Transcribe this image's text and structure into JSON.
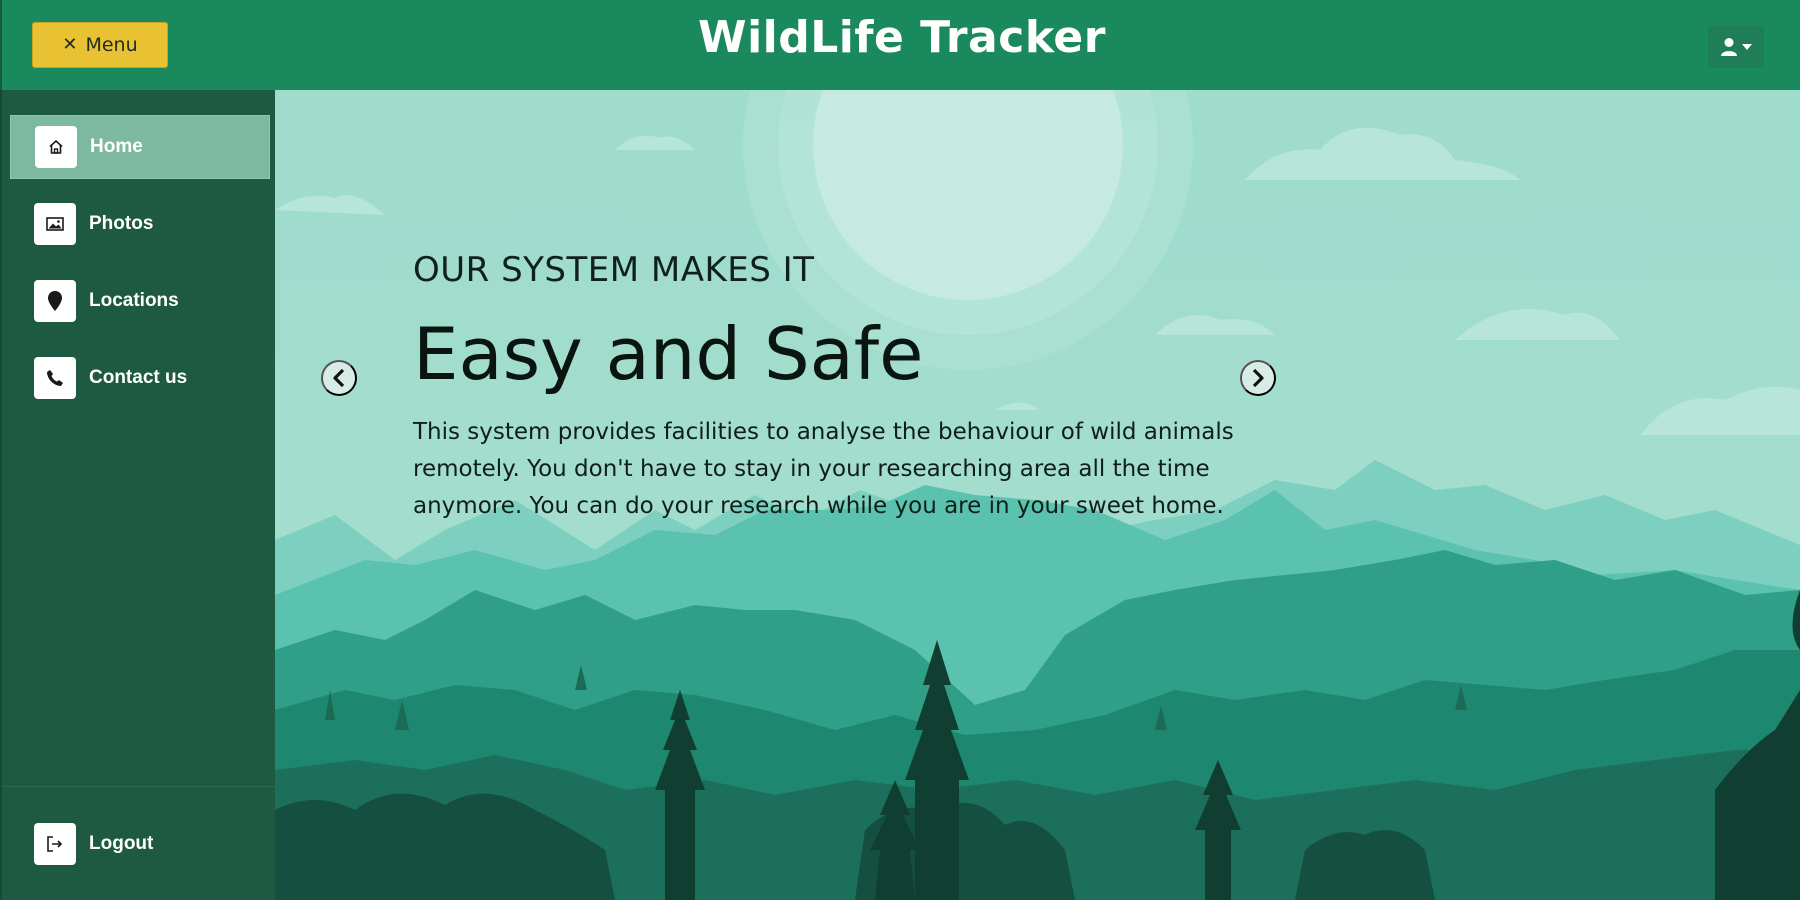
{
  "header": {
    "menu_label": "Menu",
    "menu_icon": "close-icon",
    "brand": "WildLife Tracker",
    "user_icon": "user-icon"
  },
  "sidebar": {
    "items": [
      {
        "label": "Home",
        "icon": "home-icon",
        "active": true
      },
      {
        "label": "Photos",
        "icon": "image-icon",
        "active": false
      },
      {
        "label": "Locations",
        "icon": "map-pin-icon",
        "active": false
      },
      {
        "label": "Contact us",
        "icon": "phone-icon",
        "active": false
      }
    ],
    "logout_label": "Logout"
  },
  "hero": {
    "kicker": "OUR SYSTEM MAKES IT",
    "headline": "Easy and Safe",
    "description": "This system provides facilities to analyse the behaviour of wild animals remotely. You don't have to stay in your researching area all the time anymore. You can do your research while you are in your sweet home."
  },
  "colors": {
    "header": "#1a8a5e",
    "sidebar": "#1e5a41",
    "menu_button": "#e8c232",
    "active_item": "#7db9a0",
    "sky": "#a2dccd"
  }
}
